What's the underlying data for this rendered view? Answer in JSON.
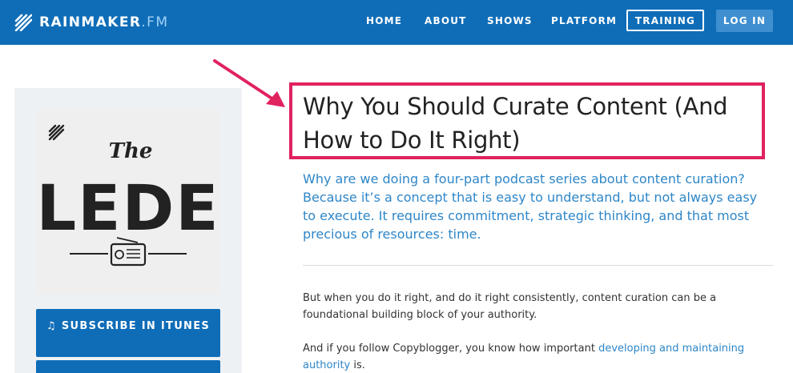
{
  "header": {
    "logo_main": "RAINMAKER",
    "logo_suffix": ".FM",
    "nav": [
      "HOME",
      "ABOUT",
      "SHOWS",
      "PLATFORM"
    ],
    "training_label": "TRAINING",
    "login_label": "LOG IN"
  },
  "sidebar": {
    "cover": {
      "line1": "The",
      "line2": "LEDE"
    },
    "subscribe_label": "SUBSCRIBE IN ITUNES"
  },
  "article": {
    "title": "Why You Should Curate Content (And How to Do It Right)",
    "intro": "Why are we doing a four-part podcast series about content curation? Because it’s a concept that is easy to understand, but not always easy to execute. It requires commitment, strategic thinking, and that most precious of resources: time.",
    "para1": "But when you do it right, and do it right consistently, content curation can be a foundational building block of your authority.",
    "para2_before": "And if you follow Copyblogger, you know how important ",
    "para2_link": "developing and maintaining authority",
    "para2_after": " is."
  },
  "colors": {
    "header_bg": "#0f6db8",
    "accent_link": "#2e86c8",
    "highlight": "#e0225f",
    "login_bg": "#3f8fd0"
  }
}
